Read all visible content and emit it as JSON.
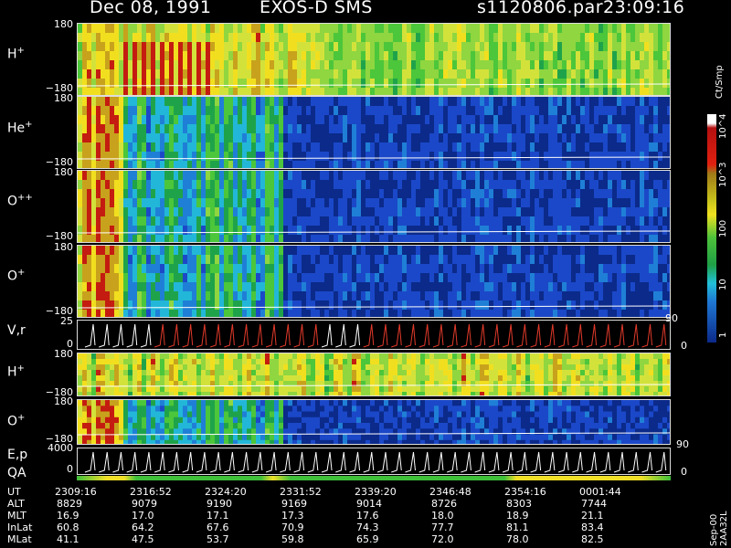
{
  "header": {
    "date": "Dec 08, 1991",
    "mission": "EXOS-D SMS",
    "file": "s1120806.par",
    "time": "23:09:16"
  },
  "panels": [
    {
      "id": "h-plus-1",
      "label": "H",
      "sup": "+",
      "ymax": "180",
      "ymin": "−180"
    },
    {
      "id": "he-plus",
      "label": "He",
      "sup": "+",
      "ymax": "180",
      "ymin": "−180"
    },
    {
      "id": "o-plus-plus",
      "label": "O",
      "sup": "++",
      "ymax": "180",
      "ymin": "−180"
    },
    {
      "id": "o-plus-1",
      "label": "O",
      "sup": "+",
      "ymax": "180",
      "ymin": "−180"
    },
    {
      "id": "v-r",
      "label": "V,r",
      "sup": "",
      "ymax": "25",
      "ymin": "0",
      "right": "90",
      "right2": "0"
    },
    {
      "id": "h-plus-2",
      "label": "H",
      "sup": "+",
      "ymax": "180",
      "ymin": "−180"
    },
    {
      "id": "o-plus-2",
      "label": "O",
      "sup": "+",
      "ymax": "180",
      "ymin": "−180",
      "right": "90"
    },
    {
      "id": "e-p",
      "label": "E,p",
      "sup": "",
      "ymax": "4000",
      "ymin": "0",
      "right": "0"
    }
  ],
  "qa_label": "QA",
  "colorbar": {
    "unit": "Ct/Smp",
    "ticks": [
      "10^4",
      "10^3",
      "100",
      "10",
      "1"
    ]
  },
  "side_label": "Sep-00 2AA32L",
  "ephemeris": {
    "rows": [
      {
        "name": "UT",
        "values": [
          "2309:16",
          "2316:52",
          "2324:20",
          "2331:52",
          "2339:20",
          "2346:48",
          "2354:16",
          "0001:44"
        ]
      },
      {
        "name": "ALT",
        "values": [
          "8829",
          "9079",
          "9190",
          "9169",
          "9014",
          "8726",
          "8303",
          "7744"
        ]
      },
      {
        "name": "MLT",
        "values": [
          "16.9",
          "17.0",
          "17.1",
          "17.3",
          "17.6",
          "18.0",
          "18.9",
          "21.1"
        ]
      },
      {
        "name": "InLat",
        "values": [
          "60.8",
          "64.2",
          "67.6",
          "70.9",
          "74.3",
          "77.7",
          "81.1",
          "83.4"
        ]
      },
      {
        "name": "MLat",
        "values": [
          "41.1",
          "47.5",
          "53.7",
          "59.8",
          "65.9",
          "72.0",
          "78.0",
          "82.5"
        ]
      }
    ]
  },
  "chart_data": {
    "type": "heatmap",
    "title": "Dec 08, 1991 EXOS-D SMS",
    "x": [
      "2309:16",
      "2316:52",
      "2324:20",
      "2331:52",
      "2339:20",
      "2346:48",
      "2354:16",
      "0001:44"
    ],
    "series": [
      {
        "name": "H+",
        "ylim": [
          -180,
          180
        ]
      },
      {
        "name": "He+",
        "ylim": [
          -180,
          180
        ]
      },
      {
        "name": "O++",
        "ylim": [
          -180,
          180
        ]
      },
      {
        "name": "O+",
        "ylim": [
          -180,
          180
        ]
      },
      {
        "name": "V,r",
        "ylim": [
          0,
          25
        ]
      },
      {
        "name": "H+",
        "ylim": [
          -180,
          180
        ]
      },
      {
        "name": "O+",
        "ylim": [
          -180,
          180
        ]
      },
      {
        "name": "E,p",
        "ylim": [
          0,
          4000
        ]
      }
    ],
    "colorscale": {
      "unit": "Ct/Smp",
      "range": [
        1,
        10000
      ],
      "log": true
    }
  }
}
